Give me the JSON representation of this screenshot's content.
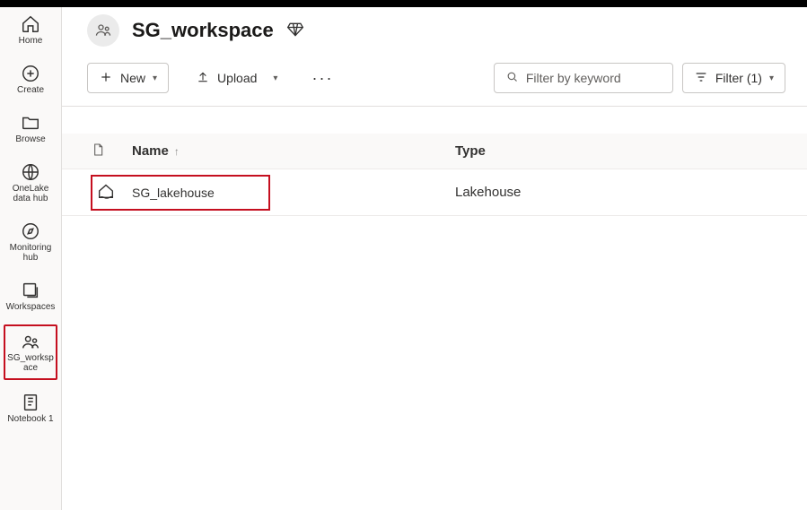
{
  "sidebar": {
    "items": [
      {
        "label": "Home"
      },
      {
        "label": "Create"
      },
      {
        "label": "Browse"
      },
      {
        "label": "OneLake data hub"
      },
      {
        "label": "Monitoring hub"
      },
      {
        "label": "Workspaces"
      },
      {
        "label": "SG_workspace"
      },
      {
        "label": "Notebook 1"
      }
    ]
  },
  "header": {
    "title": "SG_workspace"
  },
  "toolbar": {
    "new_label": "New",
    "upload_label": "Upload",
    "filter_label": "Filter (1)",
    "search_placeholder": "Filter by keyword"
  },
  "columns": {
    "name": "Name",
    "type": "Type"
  },
  "rows": [
    {
      "name": "SG_lakehouse",
      "type": "Lakehouse"
    }
  ]
}
